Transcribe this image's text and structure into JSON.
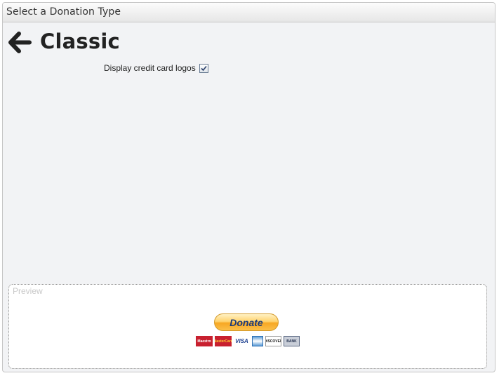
{
  "dialog": {
    "title": "Select a Donation Type"
  },
  "header": {
    "back_icon": "arrow-left-icon",
    "title": "Classic"
  },
  "option": {
    "label": "Display credit card logos",
    "checked": true
  },
  "preview": {
    "label": "Preview",
    "donate_button": "Donate",
    "card_logos": [
      "Maestro",
      "MasterCard",
      "VISA",
      "",
      "DISCOVER",
      "BANK"
    ]
  },
  "colors": {
    "background": "#f2f3f5",
    "donate_gold": "#f7a823",
    "donate_text": "#1b3a7a"
  }
}
